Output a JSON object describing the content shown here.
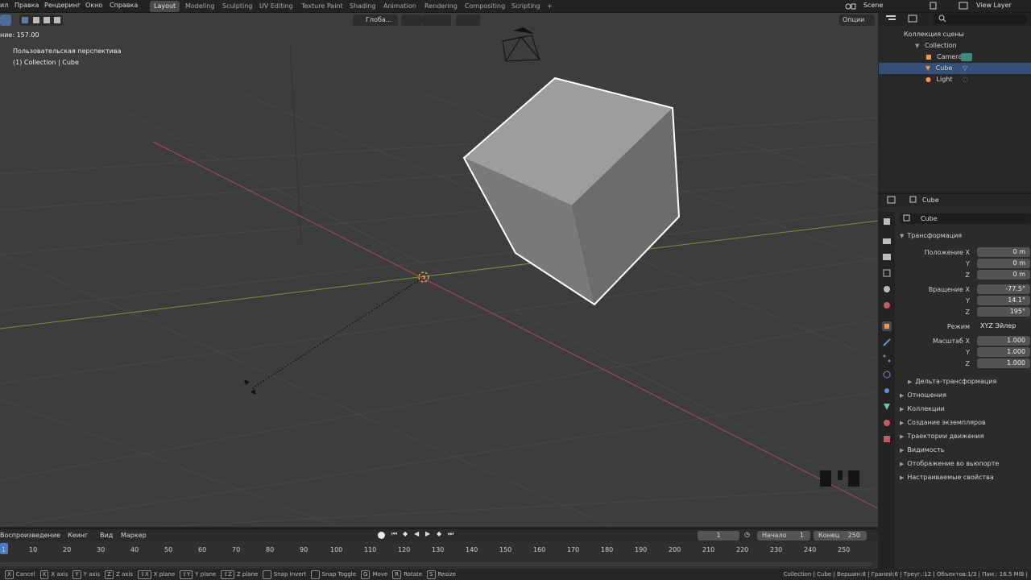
{
  "top_menu": [
    "ил",
    "Правка",
    "Рендеринг",
    "Окно",
    "Справка"
  ],
  "workspaces": [
    "Layout",
    "Modeling",
    "Sculpting",
    "UV Editing",
    "Texture Paint",
    "Shading",
    "Animation",
    "Rendering",
    "Compositing",
    "Scripting"
  ],
  "workspace_add": "+",
  "scene_label": "Scene",
  "view_layer_label": "View Layer",
  "viewport": {
    "transform_orientation": "Глоба...",
    "options_label": "Опции",
    "operator_readout": "ние: 157.00",
    "view_name": "Пользовательская перспектива",
    "collection_info": "(1) Collection | Cube"
  },
  "outliner": {
    "scene_collection": "Коллекция сцены",
    "items": [
      "Collection",
      "Camera",
      "Cube",
      "Light"
    ]
  },
  "properties": {
    "object_name_header": "Cube",
    "object_name_field": "Cube",
    "transform_title": "Трансформация",
    "location": {
      "label": "Положение X",
      "x": "0 m",
      "y": "0 m",
      "z": "0 m"
    },
    "rotation": {
      "label": "Вращение X",
      "x": "-77.5°",
      "y": "14.1°",
      "z": "195°"
    },
    "mode_label": "Режим",
    "mode_value": "XYZ Эйлер",
    "scale": {
      "label": "Масштаб X",
      "x": "1.000",
      "y": "1.000",
      "z": "1.000"
    },
    "axis_y": "Y",
    "axis_z": "Z",
    "delta_transform": "Дельта-трансформация",
    "panels": [
      "Отношения",
      "Коллекции",
      "Создание экземпляров",
      "Траектории движения",
      "Видимость",
      "Отображение во вьюпорте",
      "Настраиваемые свойства"
    ]
  },
  "timeline": {
    "menus": [
      "Воспроизведение",
      "Кеинг",
      "Вид",
      "Маркер"
    ],
    "current_frame": "1",
    "start_label": "Начало",
    "start_value": "1",
    "end_label": "Конец",
    "end_value": "250",
    "ticks": [
      "1",
      "10",
      "20",
      "30",
      "40",
      "50",
      "60",
      "70",
      "80",
      "90",
      "100",
      "110",
      "120",
      "130",
      "140",
      "150",
      "160",
      "170",
      "180",
      "190",
      "200",
      "210",
      "220",
      "230",
      "240",
      "250"
    ]
  },
  "statusbar": {
    "hints": [
      {
        "key": "X",
        "label": "Cancel"
      },
      {
        "key": "X",
        "label": "X axis"
      },
      {
        "key": "Y",
        "label": "Y axis"
      },
      {
        "key": "Z",
        "label": "Z axis"
      },
      {
        "key": "⇧X",
        "label": "X plane"
      },
      {
        "key": "⇧Y",
        "label": "Y plane"
      },
      {
        "key": "⇧Z",
        "label": "Z plane"
      },
      {
        "key": "",
        "label": "Snap Invert"
      },
      {
        "key": "",
        "label": "Snap Toggle"
      },
      {
        "key": "G",
        "label": "Move"
      },
      {
        "key": "R",
        "label": "Rotate"
      },
      {
        "key": "S",
        "label": "Resize"
      }
    ],
    "stats": "Collection | Cube | Вершин:8 | Граней:6 | Треуг.:12 | Объектов:1/3 | Пам.: 16.5 MiB |"
  },
  "colors": {
    "x_axis": "#b5484c",
    "y_axis": "#6e9a35",
    "selection": "#334f7a",
    "active_object": "#f09a3e"
  }
}
